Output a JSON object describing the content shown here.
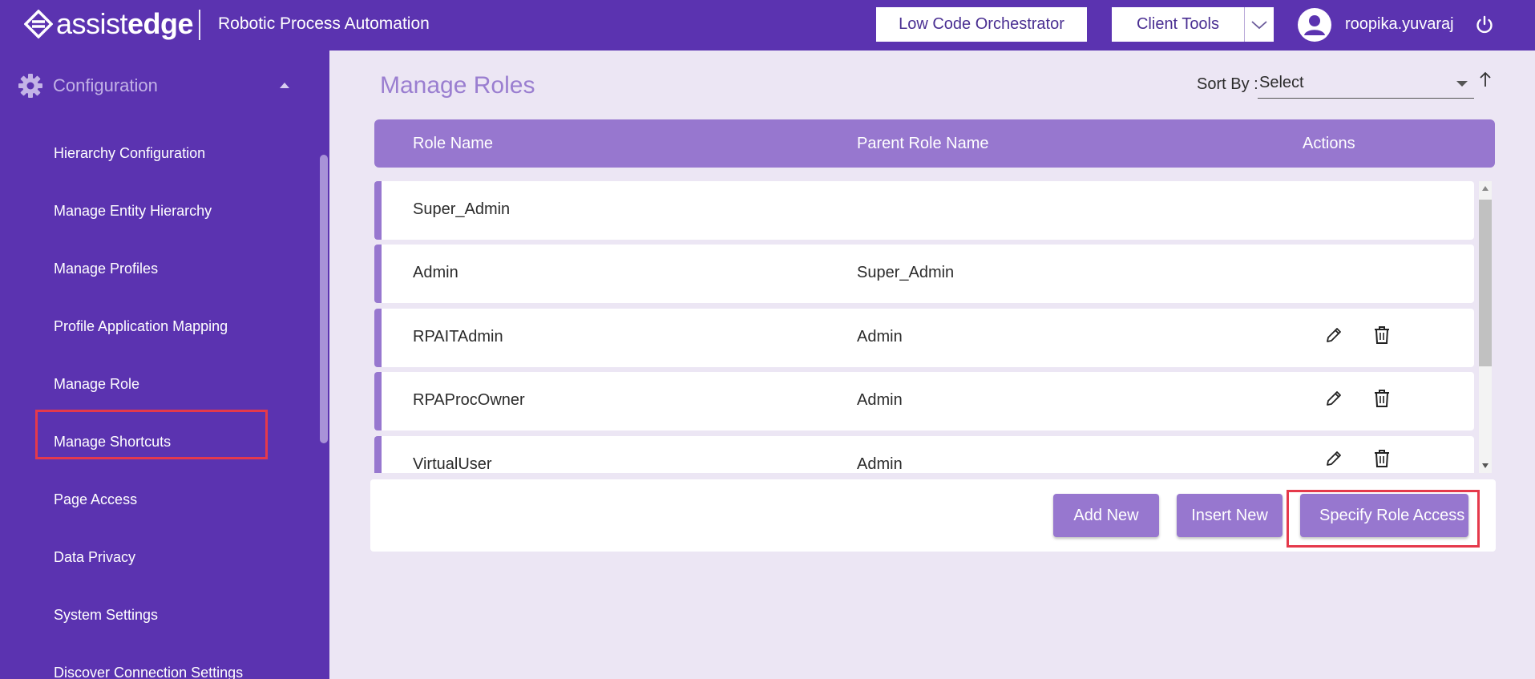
{
  "header": {
    "logo_text_light": "assist",
    "logo_text_bold": "edge",
    "app_title": "Robotic Process Automation",
    "orchestrator_button": "Low Code Orchestrator",
    "client_tools_button": "Client Tools",
    "username": "roopika.yuvaraj"
  },
  "sidebar": {
    "section": "Configuration",
    "items": [
      {
        "label": "Hierarchy Configuration"
      },
      {
        "label": "Manage Entity Hierarchy"
      },
      {
        "label": "Manage Profiles"
      },
      {
        "label": "Profile Application Mapping"
      },
      {
        "label": "Manage Role"
      },
      {
        "label": "Manage Shortcuts"
      },
      {
        "label": "Page Access"
      },
      {
        "label": "Data Privacy"
      },
      {
        "label": "System Settings"
      },
      {
        "label": "Discover Connection Settings"
      }
    ],
    "active_item": "Manage Role"
  },
  "main": {
    "title": "Manage Roles",
    "sort_label": "Sort By :",
    "sort_value": "Select",
    "columns": [
      "Role Name",
      "Parent Role Name",
      "Actions"
    ],
    "rows": [
      {
        "role": "Super_Admin",
        "parent": ""
      },
      {
        "role": "Admin",
        "parent": "Super_Admin"
      },
      {
        "role": "RPAITAdmin",
        "parent": "Admin"
      },
      {
        "role": "RPAProcOwner",
        "parent": "Admin"
      },
      {
        "role": "VirtualUser",
        "parent": "Admin"
      }
    ],
    "buttons": {
      "add_new": "Add New",
      "insert_new": "Insert New",
      "specify_role_access": "Specify Role Access"
    }
  },
  "colors": {
    "primary": "#5b33b0",
    "accent": "#9777cf",
    "background": "#ece6f4",
    "highlight": "#e5394b"
  },
  "icons": [
    "logo-icon",
    "chevron-down-icon",
    "user-avatar-icon",
    "power-icon",
    "gear-icon",
    "caret-up-icon",
    "arrow-up-icon",
    "pencil-icon",
    "trash-icon"
  ]
}
